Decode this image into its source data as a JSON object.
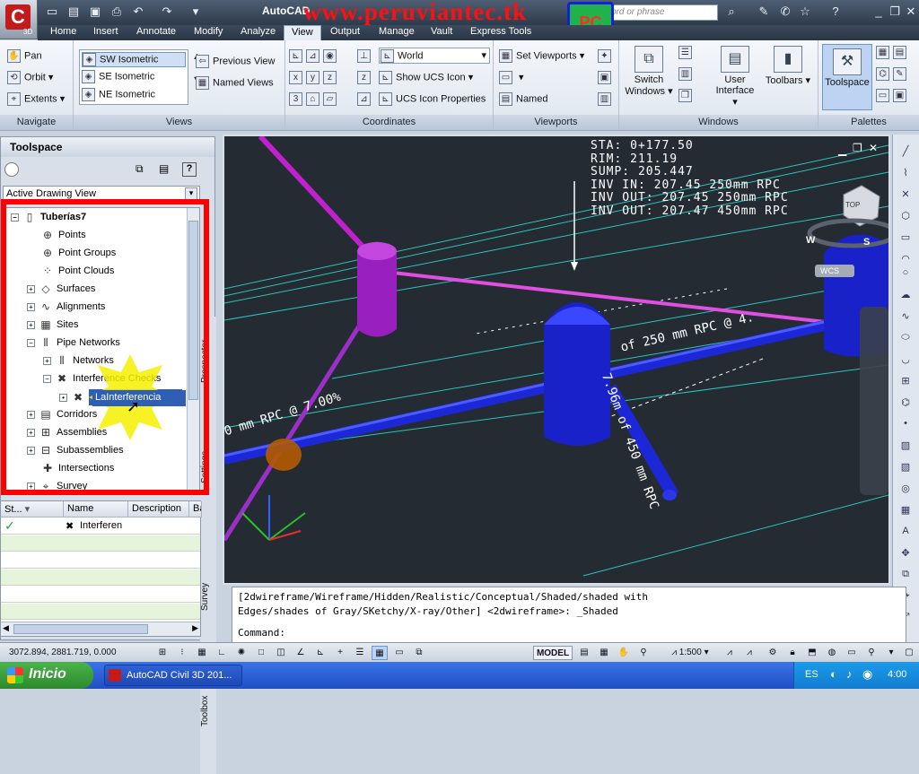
{
  "app": {
    "version_badge": "3D",
    "title": "AutoCAD",
    "watermark": "www.peruviantec.tk",
    "logo_text": "PC",
    "search_placeholder": "ord or phrase"
  },
  "menu_tabs": [
    "Home",
    "Insert",
    "Annotate",
    "Modify",
    "Analyze",
    "View",
    "Output",
    "Manage",
    "Vault",
    "Express Tools"
  ],
  "active_tab": "View",
  "ribbon": {
    "navigate": {
      "title": "Navigate",
      "pan": "Pan",
      "orbit": "Orbit",
      "extents": "Extents"
    },
    "views": {
      "title": "Views",
      "items": [
        "SW Isometric",
        "SE Isometric",
        "NE Isometric"
      ],
      "previous": "Previous View",
      "named": "Named Views"
    },
    "coordinates": {
      "title": "Coordinates",
      "world": "World",
      "show_ucs": "Show UCS Icon",
      "ucs_props": "UCS Icon Properties"
    },
    "viewports": {
      "title": "Viewports",
      "set": "Set Viewports",
      "named": "Named"
    },
    "windows": {
      "title": "Windows",
      "switch": "Switch Windows",
      "ui": "User Interface",
      "toolbars": "Toolbars"
    },
    "palettes": {
      "title": "Palettes",
      "toolspace": "Toolspace"
    }
  },
  "toolspace": {
    "title": "Toolspace",
    "view_select": "Active Drawing View",
    "side_tabs": [
      "Prospector",
      "Settings",
      "Survey",
      "Toolbox"
    ],
    "root": "Tuberías7",
    "nodes": [
      "Points",
      "Point Groups",
      "Point Clouds",
      "Surfaces",
      "Alignments",
      "Sites",
      "Pipe Networks",
      "Networks",
      "Interference Checks",
      "LaInterferencia",
      "Corridors",
      "Assemblies",
      "Subassemblies",
      "Intersections",
      "Survey"
    ]
  },
  "grid": {
    "headers": [
      "St...",
      "Name",
      "Description",
      "Ba"
    ],
    "row1_name": "Interferen"
  },
  "viewport": {
    "labels": [
      "STA: 0+177.50",
      "RIM: 211.19",
      "SUMP: 205.447",
      "INV IN: 207.45 250mm RPC",
      "INV OUT: 207.45 250mm RPC",
      "INV OUT: 207.47 450mm RPC"
    ],
    "pipe_label_1": "0 mm RPC @ 7.00%",
    "pipe_label_2": "of 250 mm RPC @ 4.",
    "pipe_label_3": "7.96m of 450 mm RPC",
    "cube_top": "TOP",
    "cube_w": "W",
    "cube_s": "S",
    "wcs": "WCS"
  },
  "command": {
    "line1": "[2dwireframe/Wireframe/Hidden/Realistic/Conceptual/Shaded/shaded with",
    "line2": "Edges/shades of Gray/SKetchy/X-ray/Other] <2dwireframe>: _Shaded",
    "prompt": "Command:"
  },
  "status": {
    "coords": "3072.894, 2881.719, 0.000",
    "model": "MODEL",
    "scale": "1:500"
  },
  "taskbar": {
    "start": "Inicio",
    "task": "AutoCAD Civil 3D 201...",
    "lang": "ES",
    "clock": "4:00"
  }
}
